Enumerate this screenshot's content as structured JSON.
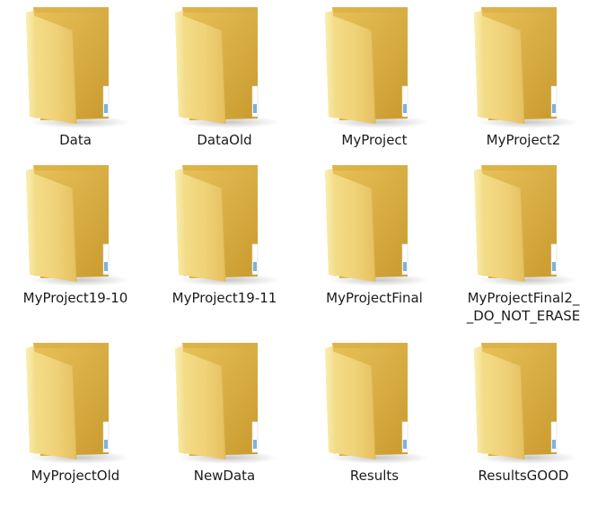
{
  "explorer": {
    "view": "large-icons",
    "icon": "folder-icon",
    "colors": {
      "background": "#ffffff",
      "label_text": "#1b1b1b",
      "folder_front": "#f1d982",
      "folder_back": "#e0b94e",
      "folder_side": "#f8ea9f"
    },
    "items": [
      {
        "label": "Data"
      },
      {
        "label": "DataOld"
      },
      {
        "label": "MyProject"
      },
      {
        "label": "MyProject2"
      },
      {
        "label": "MyProject19-10"
      },
      {
        "label": "MyProject19-11"
      },
      {
        "label": "MyProjectFinal"
      },
      {
        "label": "MyProjectFinal2_\n_DO_NOT_ERASE"
      },
      {
        "label": "MyProjectOld"
      },
      {
        "label": "NewData"
      },
      {
        "label": "Results"
      },
      {
        "label": "ResultsGOOD"
      }
    ]
  }
}
